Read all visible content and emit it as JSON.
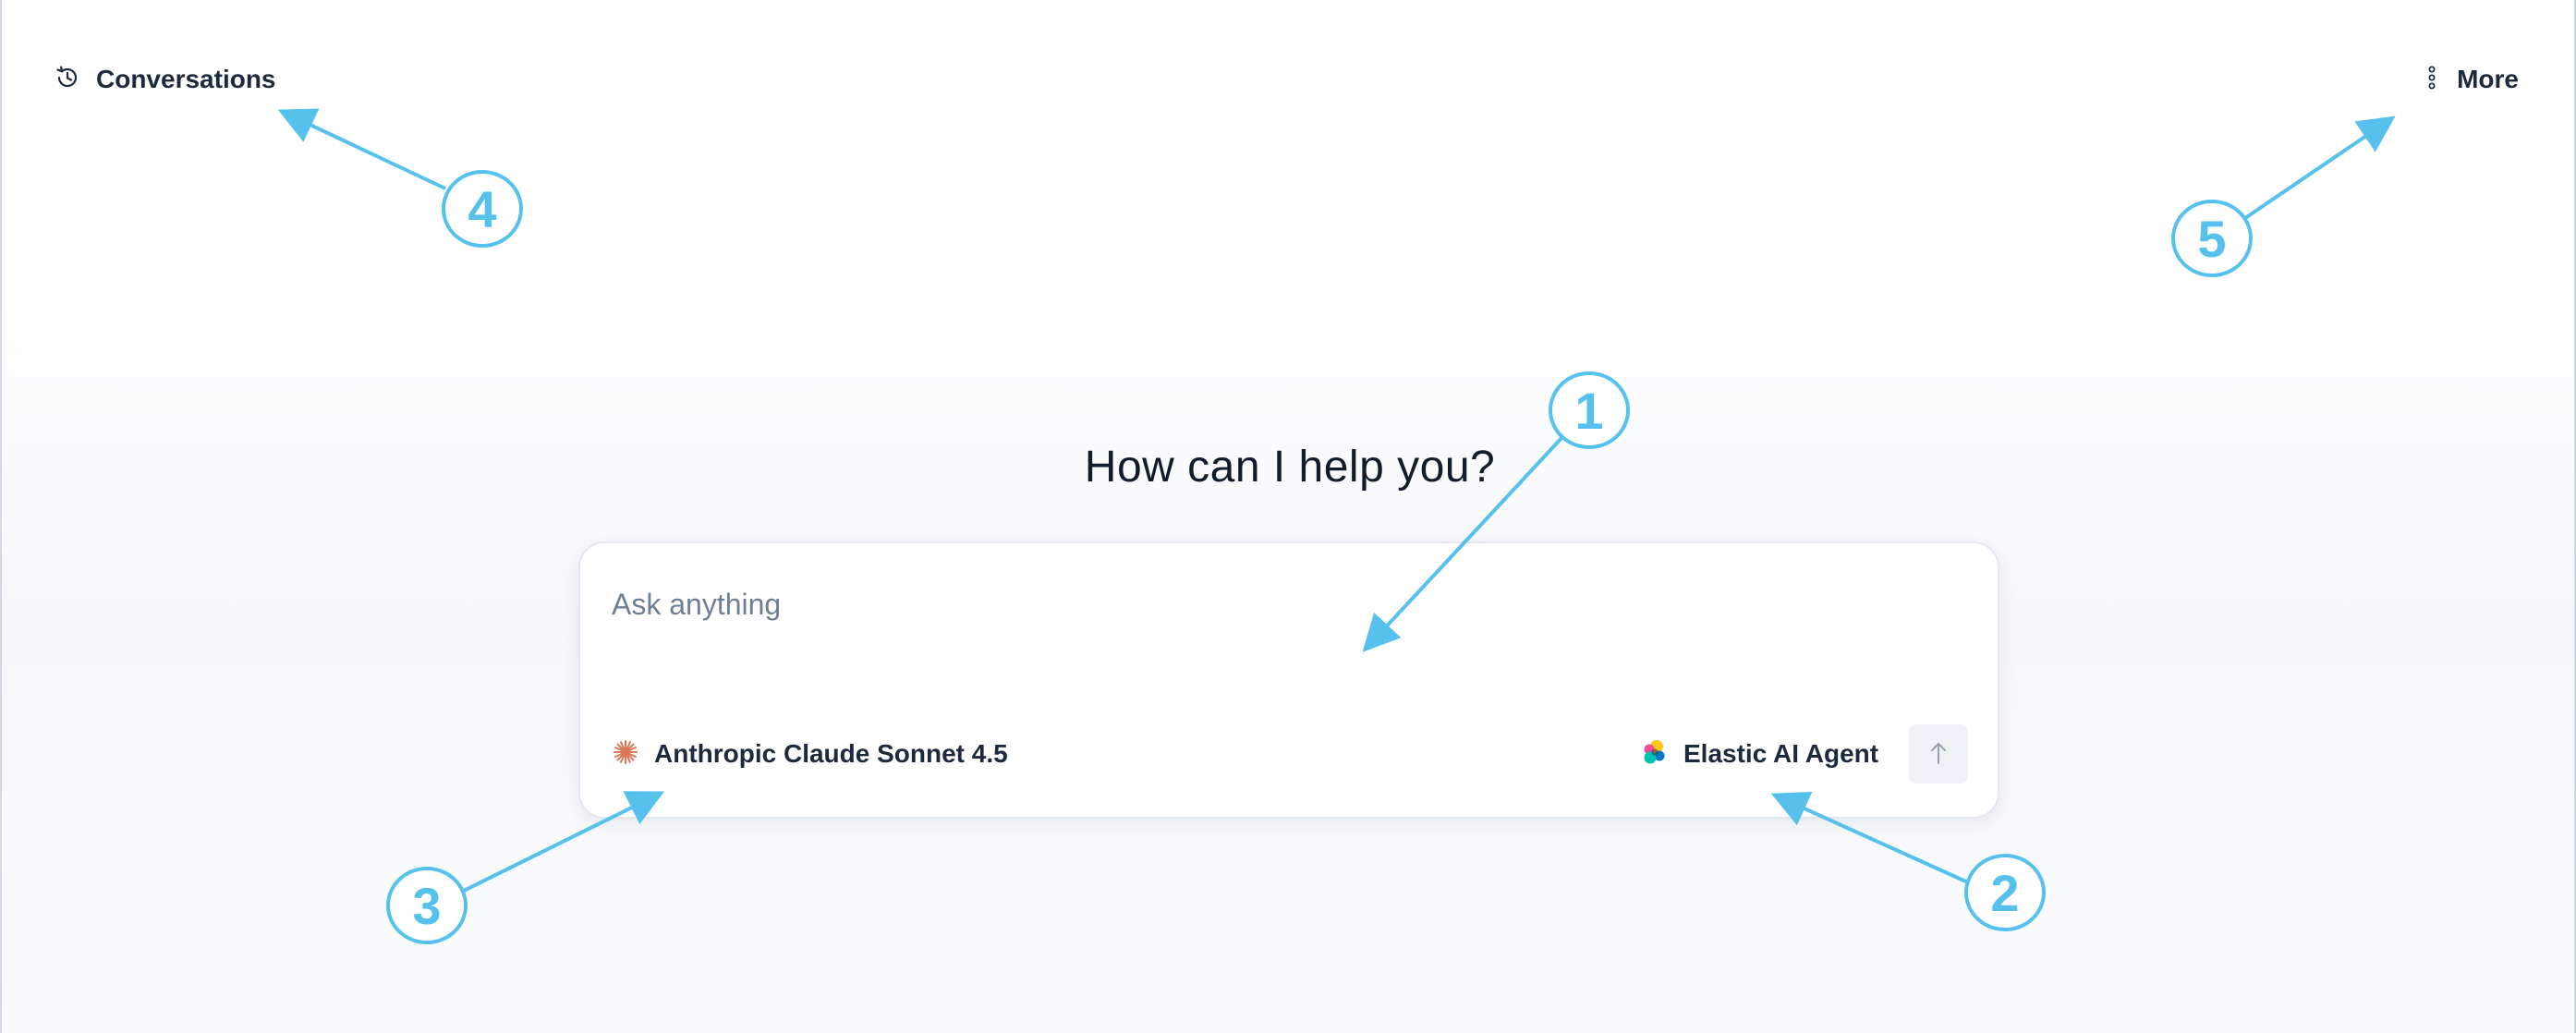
{
  "header": {
    "conversations_label": "Conversations",
    "conversations_icon": "history-clock-icon",
    "more_label": "More",
    "more_icon": "vertical-dots-icon"
  },
  "main": {
    "heading": "How can I help you?",
    "prompt": {
      "placeholder": "Ask anything",
      "value": ""
    },
    "model": {
      "label": "Anthropic Claude Sonnet 4.5",
      "icon": "anthropic-logo-icon",
      "icon_color": "#d97757"
    },
    "agent": {
      "label": "Elastic AI Agent",
      "icon": "elastic-logo-icon"
    },
    "send_icon": "arrow-up-icon"
  },
  "annotations": {
    "color": "#56c1ec",
    "callouts": [
      "1",
      "2",
      "3",
      "4",
      "5"
    ]
  },
  "colors": {
    "text": "#1d2a3e",
    "placeholder": "#6f7f96",
    "annotation": "#56c1ec"
  }
}
